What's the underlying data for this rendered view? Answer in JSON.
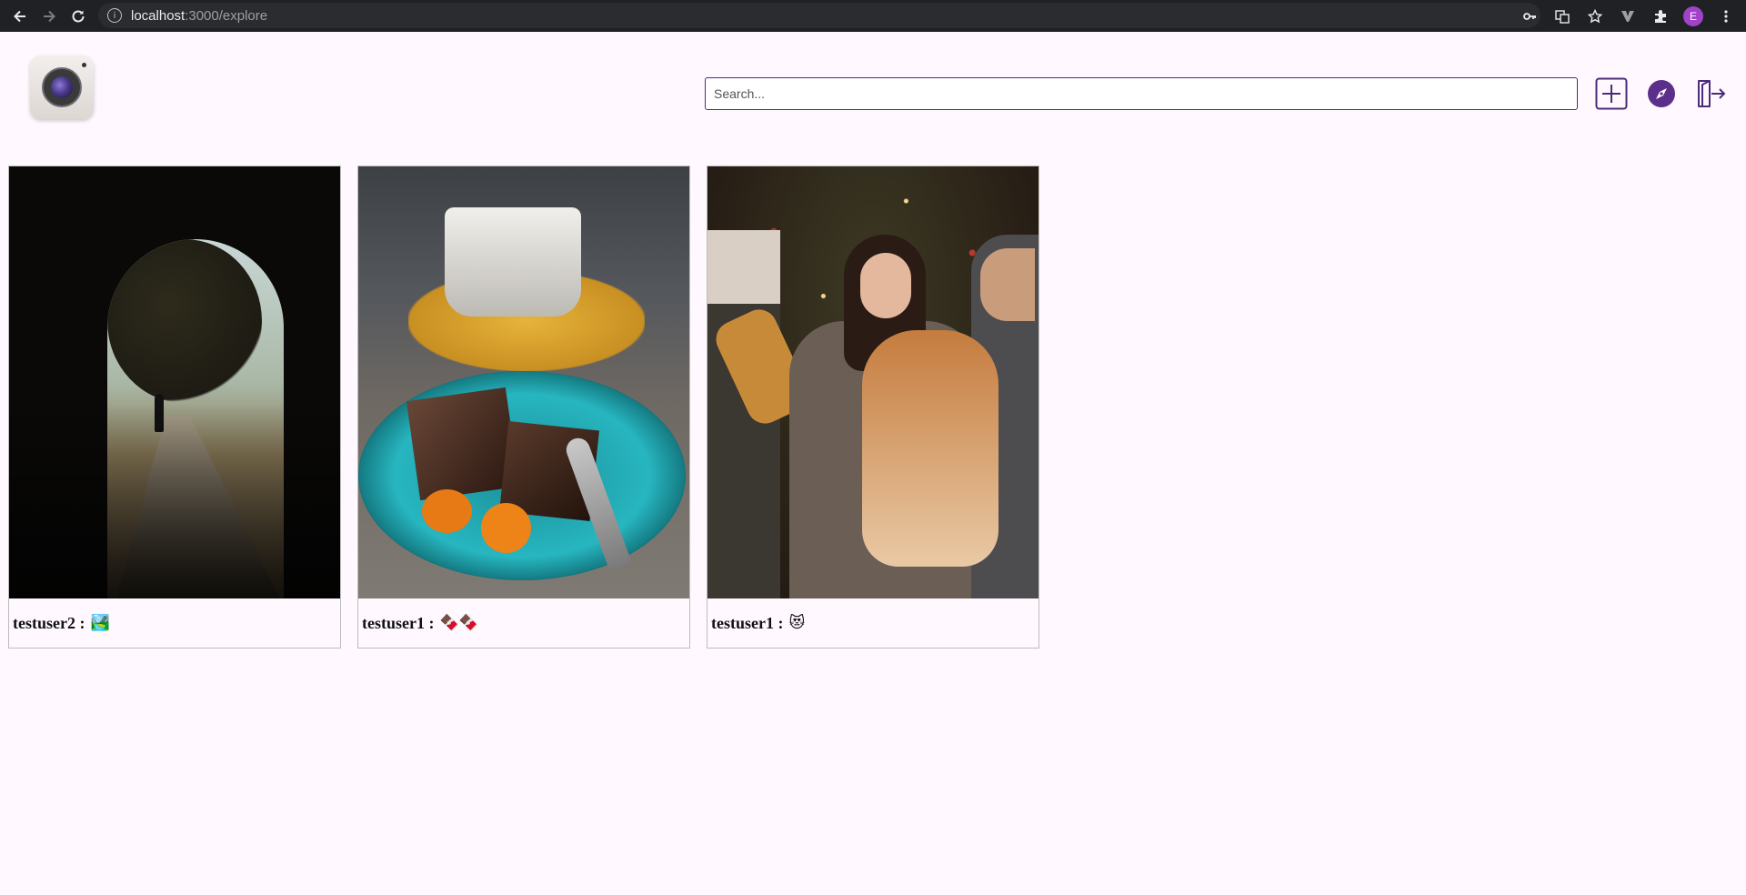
{
  "browser": {
    "url_host": "localhost",
    "url_rest": ":3000/explore",
    "profile_initial": "E"
  },
  "header": {
    "search_placeholder": "Search..."
  },
  "posts": [
    {
      "username": "testuser2",
      "separator": ":",
      "caption": "🏞️"
    },
    {
      "username": "testuser1",
      "separator": ":",
      "caption": "🍫🍫"
    },
    {
      "username": "testuser1",
      "separator": ":",
      "caption": "😻"
    }
  ],
  "colors": {
    "accent": "#4b2c7a",
    "background": "#fff8fe",
    "chrome": "#202124"
  }
}
